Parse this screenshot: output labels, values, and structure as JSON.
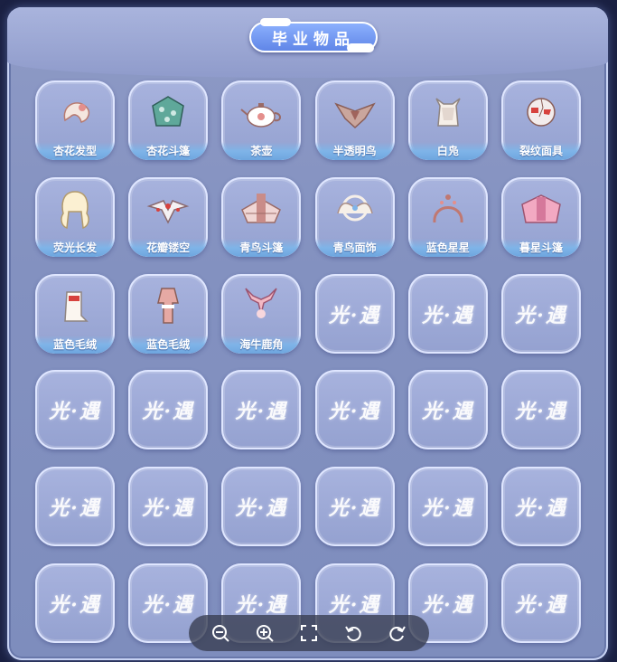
{
  "title": "毕业物品",
  "watermark": "光·遇",
  "items": [
    {
      "label": "杏花发型",
      "icon": "hair-icon"
    },
    {
      "label": "杏花斗篷",
      "icon": "cape-icon"
    },
    {
      "label": "茶壶",
      "icon": "teapot-icon"
    },
    {
      "label": "半透明鸟",
      "icon": "bird-mask-icon"
    },
    {
      "label": "白凫",
      "icon": "white-hood-icon"
    },
    {
      "label": "裂纹面具",
      "icon": "cracked-mask-icon"
    },
    {
      "label": "荧光长发",
      "icon": "long-hair-icon"
    },
    {
      "label": "花瓣镂空",
      "icon": "petal-ornament-icon"
    },
    {
      "label": "青鸟斗篷",
      "icon": "bluebird-cape-icon"
    },
    {
      "label": "青鸟面饰",
      "icon": "bluebird-face-icon"
    },
    {
      "label": "蓝色星星",
      "icon": "star-headband-icon"
    },
    {
      "label": "暮星斗篷",
      "icon": "dusk-cape-icon"
    },
    {
      "label": "蓝色毛绒",
      "icon": "fluffy-boot-icon"
    },
    {
      "label": "蓝色毛绒",
      "icon": "fluffy-outfit-icon"
    },
    {
      "label": "海牛鹿角",
      "icon": "antler-icon"
    }
  ],
  "empty_slot_count": 21,
  "toolbar": [
    {
      "name": "zoom-out-button",
      "icon": "zoom-out-icon"
    },
    {
      "name": "zoom-in-button",
      "icon": "zoom-in-icon"
    },
    {
      "name": "fullscreen-button",
      "icon": "fullscreen-icon"
    },
    {
      "name": "rotate-left-button",
      "icon": "rotate-left-icon"
    },
    {
      "name": "rotate-right-button",
      "icon": "rotate-right-icon"
    }
  ],
  "colors": {
    "accent": "#5d83e6",
    "tile": "#a0acda",
    "label_bar": "#7fb4e8"
  }
}
